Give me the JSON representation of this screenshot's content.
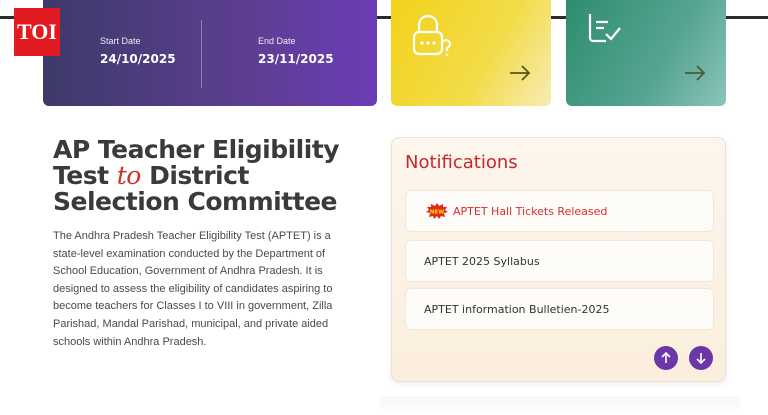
{
  "logo": {
    "text": "TOI"
  },
  "dates": {
    "start_label": "Start Date",
    "start_value": "24/10/2025",
    "end_label": "End Date",
    "end_value": "23/11/2025"
  },
  "cards": {
    "yellow_icon": "lock-question-icon",
    "green_icon": "checklist-icon",
    "arrow_icon": "arrow-right-icon"
  },
  "hero": {
    "title_part1": "AP Teacher Eligibility Test",
    "title_connector": "to",
    "title_part2": "District Selection Committee",
    "description": "The Andhra Pradesh Teacher Eligibility Test (APTET) is a state-level examination conducted by the Department of School Education, Government of Andhra Pradesh. It is designed to assess the eligibility of candidates aspiring to become teachers for Classes I to VIII in government, Zilla Parishad, Mandal Parishad, municipal, and private aided schools within Andhra Pradesh."
  },
  "notifications": {
    "title": "Notifications",
    "new_badge": "NEW",
    "items": [
      {
        "label": "APTET Hall Tickets Released"
      },
      {
        "label": "APTET 2025 Syllabus"
      },
      {
        "label": "APTET information Bulletien-2025"
      }
    ],
    "colors": {
      "title": "#c7282a",
      "nav_button": "#6a36a8"
    }
  }
}
